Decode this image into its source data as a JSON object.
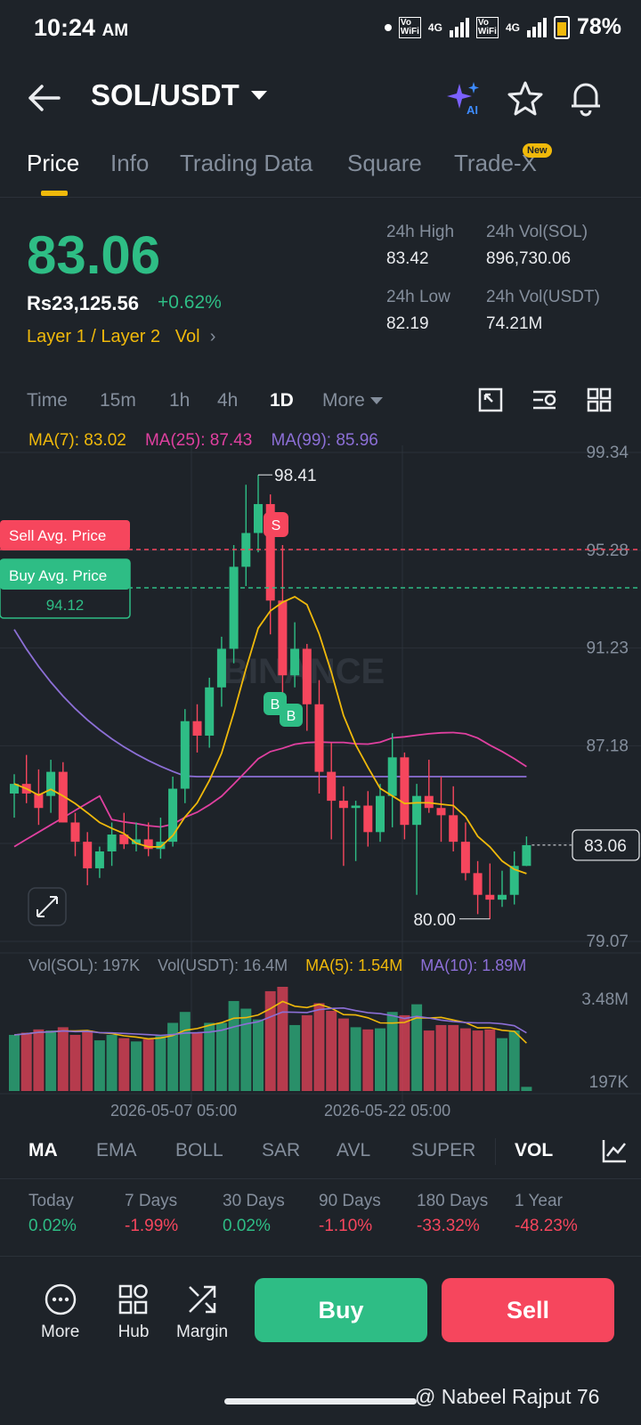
{
  "status_bar": {
    "time": "10:24",
    "ampm": "AM",
    "battery": "78%",
    "net_label": "4G",
    "volte_label_1": "Vo\nWiFi",
    "volte_label_2": "Vo\nWiFi"
  },
  "header": {
    "pair": "SOL/USDT"
  },
  "tabs": [
    {
      "label": "Price",
      "active": true
    },
    {
      "label": "Info"
    },
    {
      "label": "Trading Data"
    },
    {
      "label": "Square"
    },
    {
      "label": "Trade-X",
      "badge": "New"
    }
  ],
  "price": {
    "last": "83.06",
    "inr": "Rs23,125.56",
    "change": "+0.62%",
    "tags": "Layer 1 / Layer 2",
    "vol_link": "Vol"
  },
  "stats": {
    "high_label": "24h High",
    "high": "83.42",
    "low_label": "24h Low",
    "low": "82.19",
    "vol_sol_label": "24h Vol(SOL)",
    "vol_sol": "896,730.06",
    "vol_usdt_label": "24h Vol(USDT)",
    "vol_usdt": "74.21M"
  },
  "timeframes": [
    "Time",
    "15m",
    "1h",
    "4h",
    "1D",
    "More"
  ],
  "timeframe_active": "1D",
  "ma_legend": {
    "ma7": "MA(7): 83.02",
    "ma25": "MA(25): 87.43",
    "ma99": "MA(99): 85.96"
  },
  "vol_legend": {
    "sol": "Vol(SOL): 197K",
    "usdt": "Vol(USDT): 16.4M",
    "ma5": "MA(5): 1.54M",
    "ma10": "MA(10): 1.89M"
  },
  "chart_labels": {
    "sell_avg": "Sell Avg. Price",
    "buy_avg": "Buy Avg. Price",
    "buy_avg_value": "94.12",
    "high_marker": "98.41",
    "low_marker": "80.00",
    "last_tag": "83.06",
    "watermark": "BINANCE",
    "sell_mark": "S",
    "buy_mark": "B",
    "vol_max": "3.48M",
    "vol_min": "197K"
  },
  "colors": {
    "up": "#2ebd85",
    "down": "#f6465d",
    "accent": "#f0b90b",
    "ma7": "#f0b90b",
    "ma25": "#e040a0",
    "ma99": "#8c6fd6",
    "bg": "#1e2329"
  },
  "chart_data": {
    "type": "candlestick",
    "y_axis": [
      99.34,
      95.28,
      91.23,
      87.18,
      83.13,
      79.07
    ],
    "y_axis_labels": [
      "99.34",
      "95.28",
      "91.23",
      "87.18",
      "83.13",
      "79.07"
    ],
    "ylim": [
      79.07,
      99.34
    ],
    "x_labels": [
      "2026-05-07 05:00",
      "2026-05-22 05:00"
    ],
    "candles": [
      {
        "o": 85.2,
        "h": 86.0,
        "l": 84.2,
        "c": 85.6
      },
      {
        "o": 85.6,
        "h": 86.8,
        "l": 84.8,
        "c": 85.2
      },
      {
        "o": 85.2,
        "h": 86.2,
        "l": 83.9,
        "c": 84.6
      },
      {
        "o": 85.1,
        "h": 86.6,
        "l": 84.4,
        "c": 86.1
      },
      {
        "o": 86.1,
        "h": 86.5,
        "l": 84.0,
        "c": 84.0
      },
      {
        "o": 84.0,
        "h": 84.4,
        "l": 82.6,
        "c": 83.2
      },
      {
        "o": 83.2,
        "h": 83.6,
        "l": 81.4,
        "c": 82.1
      },
      {
        "o": 82.1,
        "h": 83.0,
        "l": 81.7,
        "c": 82.8
      },
      {
        "o": 82.8,
        "h": 84.0,
        "l": 82.2,
        "c": 83.5
      },
      {
        "o": 83.5,
        "h": 84.4,
        "l": 82.9,
        "c": 83.1
      },
      {
        "o": 83.1,
        "h": 84.0,
        "l": 82.8,
        "c": 83.3
      },
      {
        "o": 83.3,
        "h": 84.0,
        "l": 82.6,
        "c": 82.9
      },
      {
        "o": 82.9,
        "h": 84.2,
        "l": 82.5,
        "c": 83.2
      },
      {
        "o": 83.2,
        "h": 85.9,
        "l": 83.0,
        "c": 85.4
      },
      {
        "o": 85.4,
        "h": 88.7,
        "l": 84.8,
        "c": 88.2
      },
      {
        "o": 88.2,
        "h": 88.9,
        "l": 86.9,
        "c": 87.6
      },
      {
        "o": 87.6,
        "h": 90.0,
        "l": 87.1,
        "c": 89.6
      },
      {
        "o": 89.6,
        "h": 91.7,
        "l": 88.8,
        "c": 91.2
      },
      {
        "o": 91.2,
        "h": 95.5,
        "l": 90.6,
        "c": 94.6
      },
      {
        "o": 94.6,
        "h": 98.0,
        "l": 93.8,
        "c": 96.0
      },
      {
        "o": 96.0,
        "h": 98.41,
        "l": 95.2,
        "c": 97.2
      },
      {
        "o": 97.2,
        "h": 97.6,
        "l": 91.8,
        "c": 93.2
      },
      {
        "o": 93.2,
        "h": 95.5,
        "l": 89.3,
        "c": 90.1
      },
      {
        "o": 90.1,
        "h": 92.3,
        "l": 89.6,
        "c": 91.2
      },
      {
        "o": 91.2,
        "h": 91.4,
        "l": 87.8,
        "c": 88.9
      },
      {
        "o": 88.9,
        "h": 89.9,
        "l": 85.2,
        "c": 86.1
      },
      {
        "o": 86.1,
        "h": 87.3,
        "l": 83.3,
        "c": 84.9
      },
      {
        "o": 84.9,
        "h": 85.5,
        "l": 82.2,
        "c": 84.6
      },
      {
        "o": 84.6,
        "h": 84.9,
        "l": 82.4,
        "c": 84.7
      },
      {
        "o": 84.7,
        "h": 85.3,
        "l": 83.0,
        "c": 83.6
      },
      {
        "o": 83.6,
        "h": 85.6,
        "l": 83.2,
        "c": 85.1
      },
      {
        "o": 85.1,
        "h": 87.7,
        "l": 83.8,
        "c": 86.7
      },
      {
        "o": 86.7,
        "h": 86.9,
        "l": 83.3,
        "c": 83.9
      },
      {
        "o": 83.9,
        "h": 85.6,
        "l": 81.0,
        "c": 85.1
      },
      {
        "o": 85.1,
        "h": 86.6,
        "l": 84.4,
        "c": 84.6
      },
      {
        "o": 84.6,
        "h": 85.9,
        "l": 83.2,
        "c": 84.3
      },
      {
        "o": 84.3,
        "h": 85.5,
        "l": 82.8,
        "c": 83.2
      },
      {
        "o": 83.2,
        "h": 84.0,
        "l": 81.6,
        "c": 81.9
      },
      {
        "o": 81.9,
        "h": 82.4,
        "l": 80.2,
        "c": 81.0
      },
      {
        "o": 81.0,
        "h": 82.3,
        "l": 80.0,
        "c": 80.8
      },
      {
        "o": 80.8,
        "h": 82.0,
        "l": 80.5,
        "c": 81.0
      },
      {
        "o": 81.0,
        "h": 82.8,
        "l": 80.6,
        "c": 82.2
      },
      {
        "o": 82.2,
        "h": 83.42,
        "l": 82.19,
        "c": 83.06
      }
    ],
    "volume_max": 3.48
  },
  "indicators": [
    "MA",
    "EMA",
    "BOLL",
    "SAR",
    "AVL",
    "SUPER",
    "VOL"
  ],
  "indicators_active": [
    "MA",
    "VOL"
  ],
  "performance": [
    {
      "label": "Today",
      "value": "0.02%",
      "dir": "up"
    },
    {
      "label": "7 Days",
      "value": "-1.99%",
      "dir": "dn"
    },
    {
      "label": "30 Days",
      "value": "0.02%",
      "dir": "up"
    },
    {
      "label": "90 Days",
      "value": "-1.10%",
      "dir": "dn"
    },
    {
      "label": "180 Days",
      "value": "-33.32%",
      "dir": "dn"
    },
    {
      "label": "1 Year",
      "value": "-48.23%",
      "dir": "dn"
    }
  ],
  "bottom": {
    "more": "More",
    "hub": "Hub",
    "margin": "Margin",
    "buy": "Buy",
    "sell": "Sell"
  },
  "watermark": "@ Nabeel Rajput 76"
}
